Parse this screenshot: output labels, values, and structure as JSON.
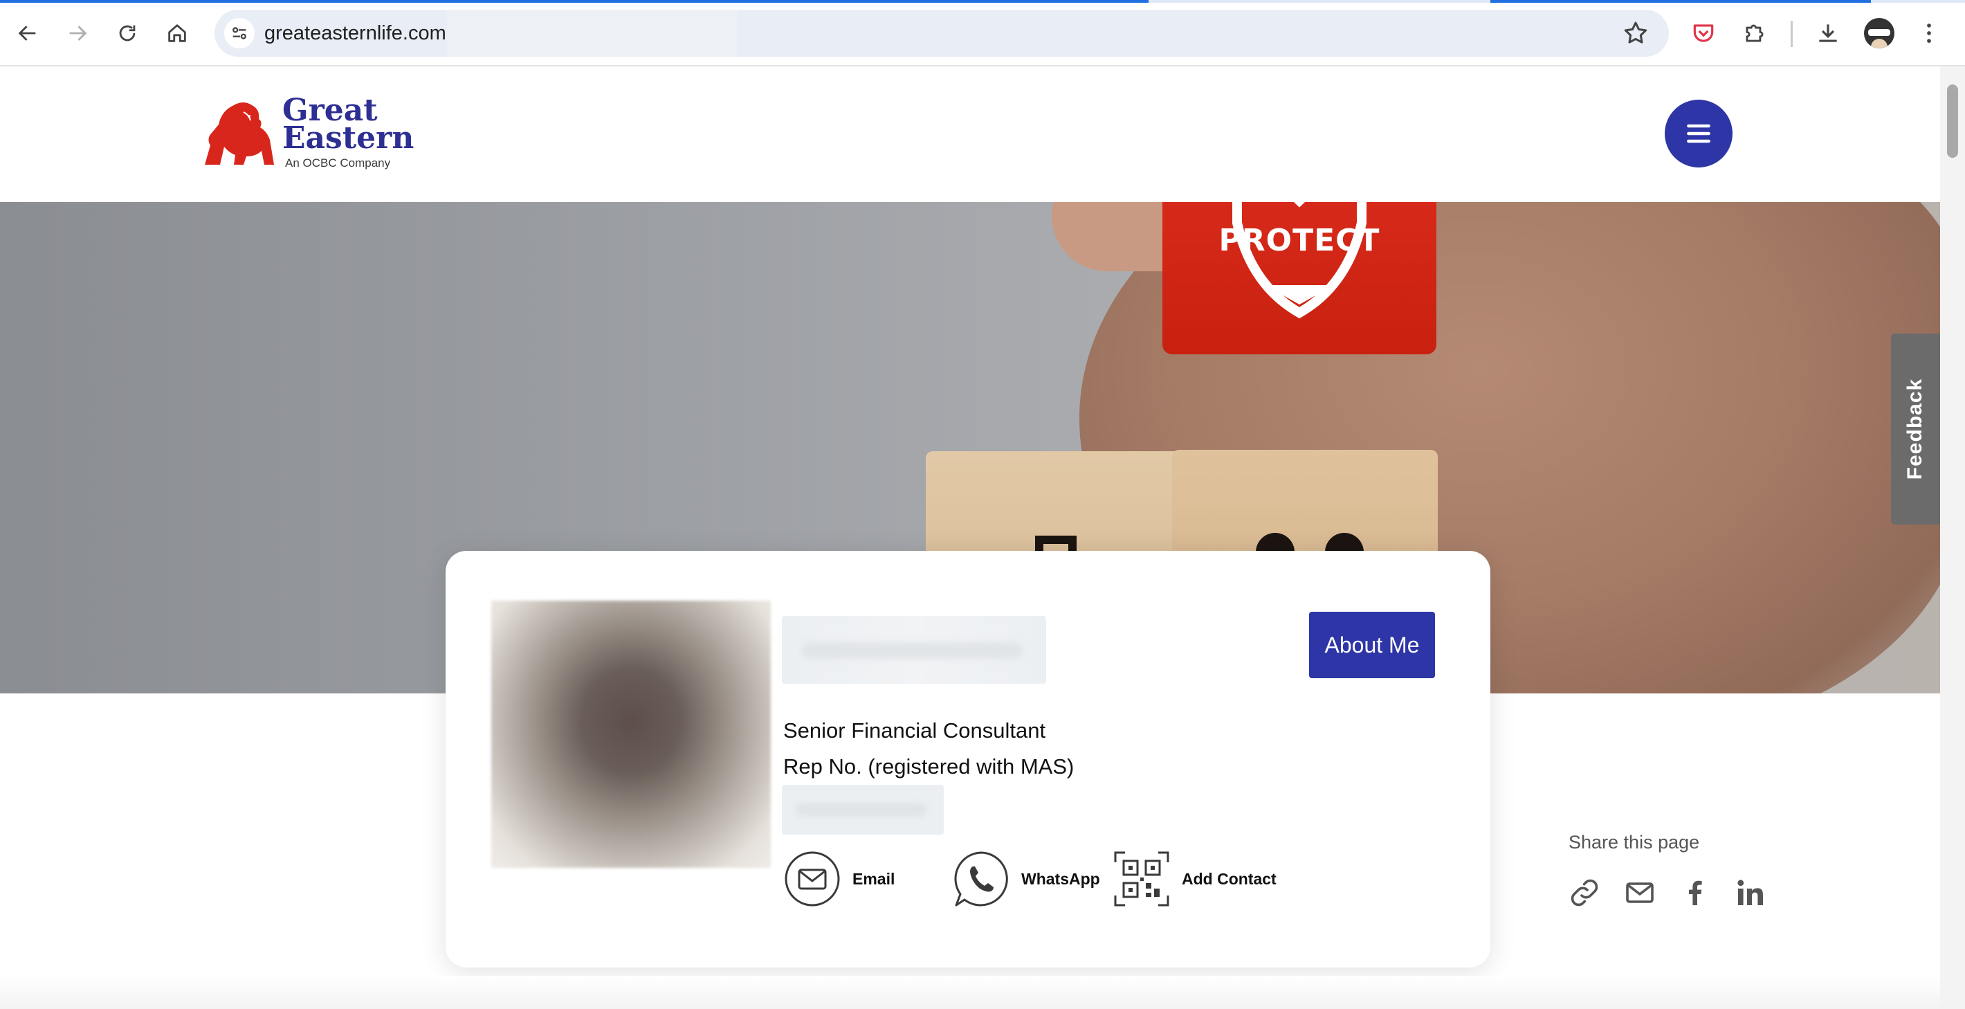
{
  "browser": {
    "url": "greateasternlife.com",
    "back_label": "Back",
    "forward_label": "Forward",
    "reload_label": "Reload",
    "home_label": "Home"
  },
  "header": {
    "logo_word1": "Great",
    "logo_word2": "Eastern",
    "logo_tagline": "An OCBC Company",
    "menu_icon": "hamburger-icon"
  },
  "hero": {
    "block_text": "PROTECT"
  },
  "feedback": {
    "label": "Feedback"
  },
  "profile": {
    "about_label": "About Me",
    "role": "Senior Financial Consultant",
    "rep_label": "Rep No. (registered with MAS)",
    "actions": [
      {
        "label": "Email",
        "icon": "email-icon"
      },
      {
        "label": "WhatsApp",
        "icon": "whatsapp-icon"
      },
      {
        "label": "Add Contact",
        "icon": "qr-code-icon"
      }
    ]
  },
  "share": {
    "title": "Share this page",
    "icons": [
      "link-icon",
      "email-icon",
      "facebook-icon",
      "linkedin-icon"
    ]
  },
  "colors": {
    "brand_blue": "#2e35a6",
    "logo_red": "#d9261c",
    "logo_navy": "#2e2f92"
  }
}
